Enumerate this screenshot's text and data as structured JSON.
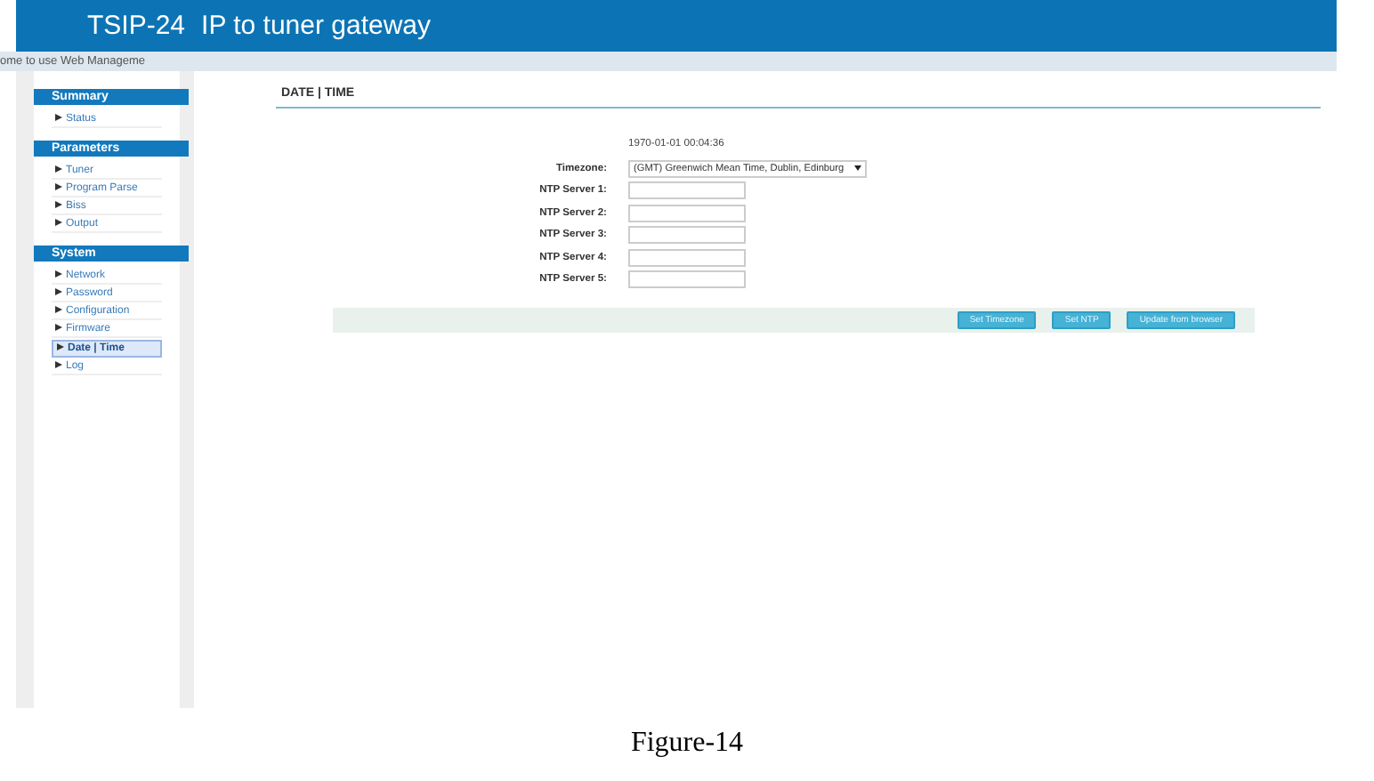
{
  "header": {
    "model": "TSIP-24",
    "title": "IP to tuner gateway"
  },
  "welcome": "ome to use Web Manageme",
  "sidebar": {
    "sections": [
      {
        "title": "Summary",
        "items": [
          {
            "label": "Status",
            "selected": false
          }
        ]
      },
      {
        "title": "Parameters",
        "items": [
          {
            "label": "Tuner",
            "selected": false
          },
          {
            "label": "Program Parse",
            "selected": false
          },
          {
            "label": "Biss",
            "selected": false
          },
          {
            "label": "Output",
            "selected": false
          }
        ]
      },
      {
        "title": "System",
        "items": [
          {
            "label": "Network",
            "selected": false
          },
          {
            "label": "Password",
            "selected": false
          },
          {
            "label": "Configuration",
            "selected": false
          },
          {
            "label": "Firmware",
            "selected": false
          },
          {
            "label": "Date | Time",
            "selected": true
          },
          {
            "label": "Log",
            "selected": false
          }
        ]
      }
    ]
  },
  "page": {
    "heading": "DATE | TIME",
    "current_time": "1970-01-01 00:04:36",
    "fields": [
      {
        "kind": "select",
        "label": "Timezone:",
        "value": "(GMT) Greenwich Mean Time, Dublin, Edinburg"
      },
      {
        "kind": "text",
        "label": "NTP Server 1:"
      },
      {
        "kind": "text",
        "label": "NTP Server 2:"
      },
      {
        "kind": "text",
        "label": "NTP Server 3:"
      },
      {
        "kind": "text",
        "label": "NTP Server 4:"
      },
      {
        "kind": "text",
        "label": "NTP Server 5:"
      }
    ],
    "buttons": [
      "Set Timezone",
      "Set NTP",
      "Update from browser"
    ]
  },
  "caption": "Figure-14"
}
